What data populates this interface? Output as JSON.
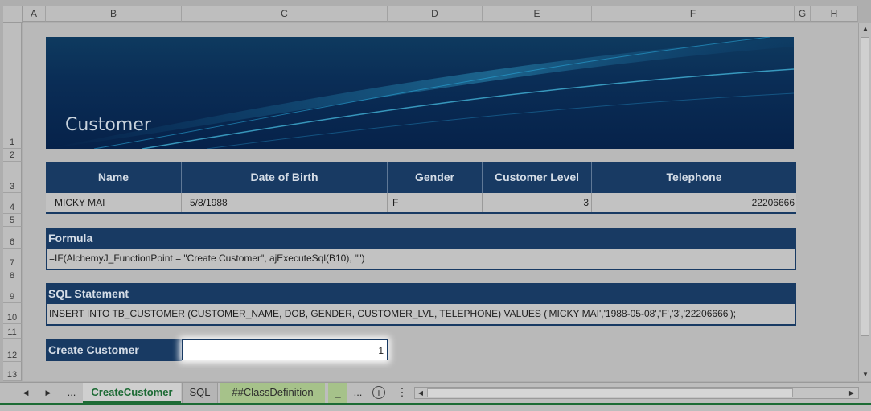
{
  "columns": [
    "A",
    "B",
    "C",
    "D",
    "E",
    "F",
    "G",
    "H"
  ],
  "rows": [
    "1",
    "2",
    "3",
    "4",
    "5",
    "6",
    "7",
    "8",
    "9",
    "10",
    "11",
    "12",
    "13"
  ],
  "banner": {
    "title": "Customer"
  },
  "customer_table": {
    "headers": [
      "Name",
      "Date of Birth",
      "Gender",
      "Customer Level",
      "Telephone"
    ],
    "row": [
      "MICKY MAI",
      "5/8/1988",
      "F",
      "3",
      "22206666"
    ]
  },
  "formula": {
    "label": "Formula",
    "value": "=IF(AlchemyJ_FunctionPoint = \"Create Customer\", ajExecuteSql(B10), \"\")"
  },
  "sql": {
    "label": "SQL Statement",
    "value": "INSERT INTO TB_CUSTOMER (CUSTOMER_NAME, DOB, GENDER, CUSTOMER_LVL, TELEPHONE) VALUES ('MICKY MAI','1988-05-08','F','3','22206666');"
  },
  "create_customer": {
    "label": "Create Customer",
    "value": "1"
  },
  "sheet_tabs": {
    "prev": "◀",
    "next": "▶",
    "ellipsis_left": "...",
    "tabs": [
      "CreateCustomer",
      "SQL",
      "##ClassDefinition",
      "_"
    ],
    "ellipsis_right": "...",
    "add": "+",
    "options": "⋮"
  },
  "colors": {
    "header_blue": "#183a63",
    "tab_active_text": "#1d6b35",
    "class_tab_bg": "#a6c28a"
  }
}
